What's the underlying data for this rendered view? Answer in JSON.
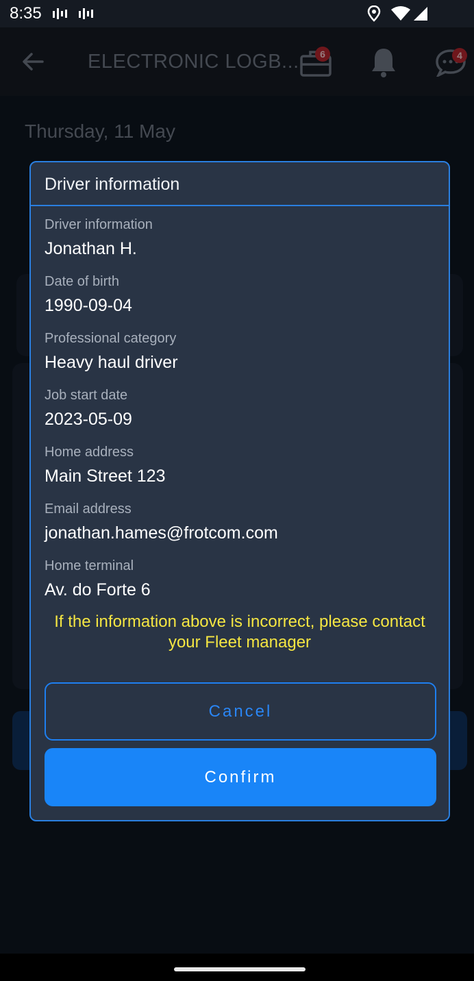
{
  "status_bar": {
    "time": "8:35"
  },
  "app_bar": {
    "title": "ELECTRONIC LOGB...",
    "briefcase_badge": "6",
    "chat_badge": "4",
    "icons": [
      "back-arrow-icon",
      "briefcase-icon",
      "bell-icon",
      "chat-icon"
    ]
  },
  "page": {
    "date": "Thursday, 11 May"
  },
  "dialog": {
    "title": "Driver information",
    "fields": [
      {
        "label": "Driver information",
        "value": "Jonathan H."
      },
      {
        "label": "Date of birth",
        "value": "1990-09-04"
      },
      {
        "label": "Professional category",
        "value": "Heavy haul driver"
      },
      {
        "label": "Job start date",
        "value": "2023-05-09"
      },
      {
        "label": "Home address",
        "value": "Main Street 123"
      },
      {
        "label": "Email address",
        "value": "jonathan.hames@frotcom.com"
      },
      {
        "label": "Home terminal",
        "value": "Av. do Forte 6"
      }
    ],
    "warning": "If the information above is incorrect, please contact your Fleet manager",
    "cancel_label": "Cancel",
    "confirm_label": "Confirm"
  },
  "colors": {
    "accent": "#1985f8",
    "warning": "#f5e642",
    "dialog_bg": "#293445",
    "badge": "#b3262e"
  }
}
